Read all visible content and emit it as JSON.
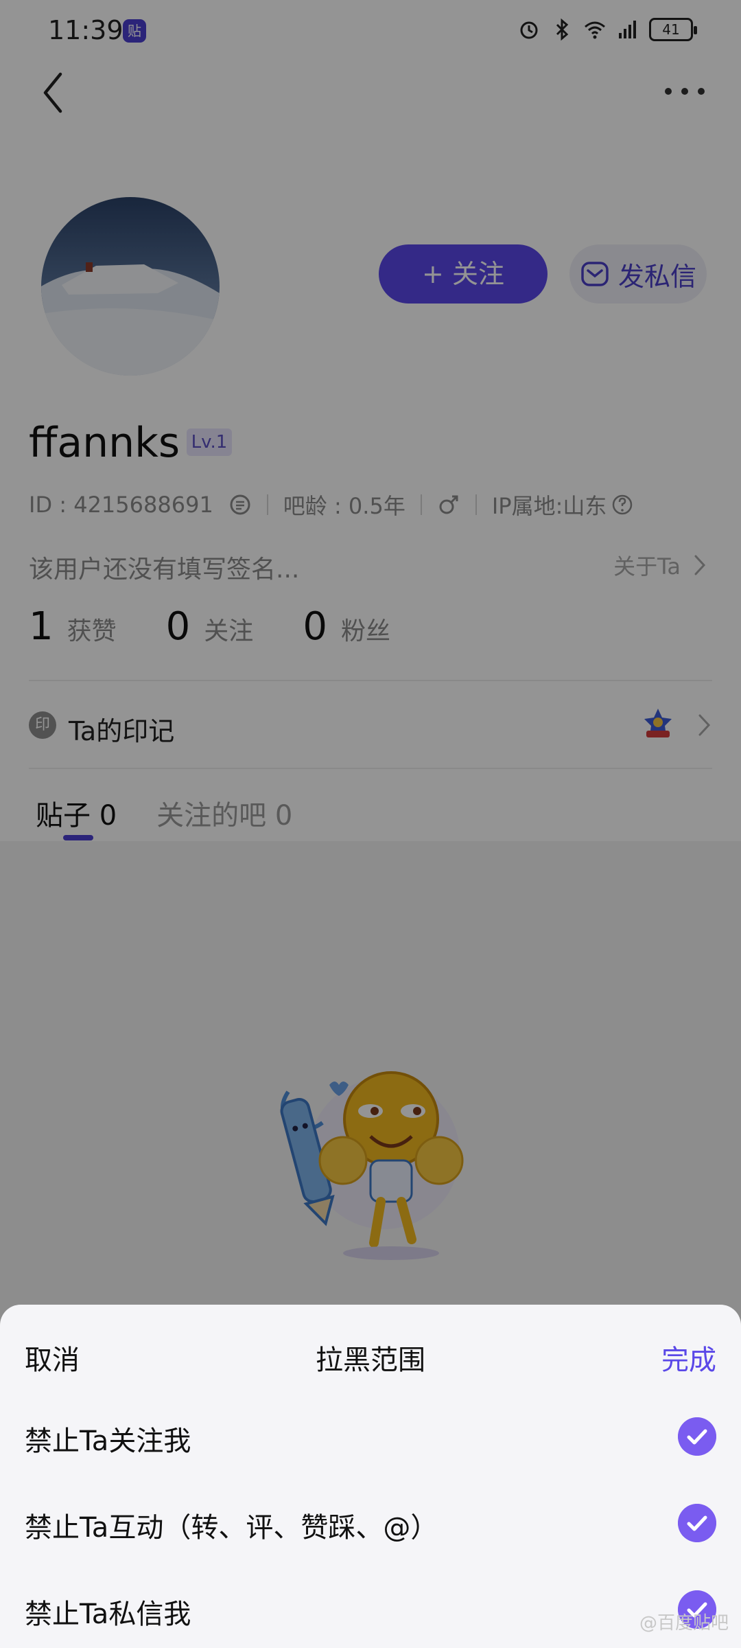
{
  "status_bar": {
    "time": "11:39",
    "app_badge": "贴",
    "battery": "41"
  },
  "profile": {
    "follow_label": "+ 关注",
    "dm_label": "发私信",
    "username": "ffannks",
    "level": "Lv.1",
    "id_text": "ID : 4215688691",
    "age_text": "吧龄 : 0.5年",
    "ip_text": "IP属地:山东",
    "signature": "该用户还没有填写签名...",
    "about_label": "关于Ta",
    "stats": [
      {
        "value": "1",
        "label": "获赞"
      },
      {
        "value": "0",
        "label": "关注"
      },
      {
        "value": "0",
        "label": "粉丝"
      }
    ],
    "mark_icon_text": "印",
    "mark_label": "Ta的印记",
    "tabs": [
      {
        "label": "贴子",
        "count": "0"
      },
      {
        "label": "关注的吧",
        "count": "0"
      }
    ]
  },
  "sheet": {
    "cancel_label": "取消",
    "title": "拉黑范围",
    "done_label": "完成",
    "options": [
      {
        "label": "禁止Ta关注我",
        "checked": true
      },
      {
        "label": "禁止Ta互动（转、评、赞踩、@）",
        "checked": true
      },
      {
        "label": "禁止Ta私信我",
        "checked": true
      }
    ]
  },
  "watermark": "@百度贴吧",
  "colors": {
    "accent": "#5a48e8",
    "check": "#7a5cf0",
    "sheet_bg": "#f5f5f8"
  }
}
